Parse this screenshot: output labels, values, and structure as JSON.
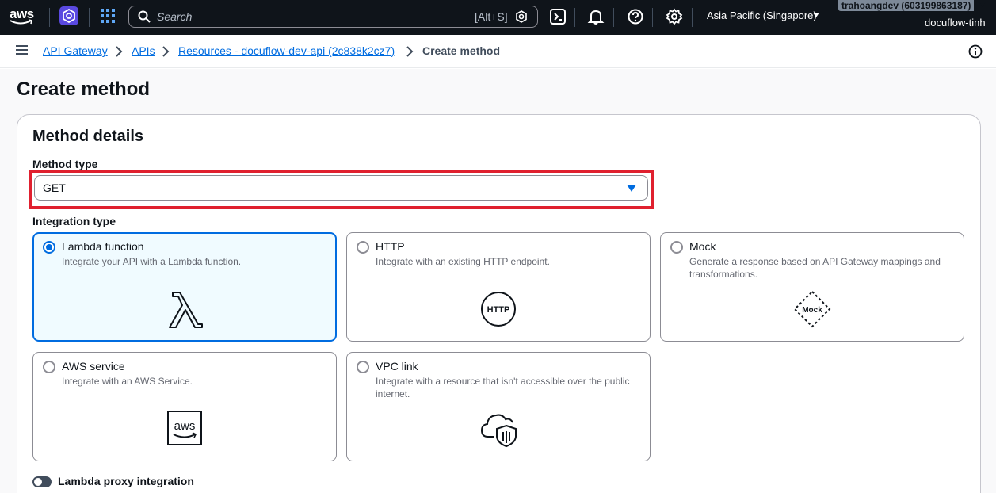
{
  "topnav": {
    "logo_text": "aws",
    "search_placeholder": "Search",
    "search_shortcut": "[Alt+S]",
    "region": "Asia Pacific (Singapore)",
    "account": "trahoangdev (603199863187)",
    "username": "docuflow-tinh",
    "icons": [
      "aws-logo",
      "service-icon",
      "apps-grid-icon",
      "search-icon",
      "cloudshell-icon",
      "bell-icon",
      "help-icon",
      "settings-icon"
    ]
  },
  "breadcrumb": {
    "items": [
      "API Gateway",
      "APIs",
      "Resources - docuflow-dev-api (2c838k2cz7)"
    ],
    "current": "Create method"
  },
  "page": {
    "title": "Create method"
  },
  "method_details": {
    "heading": "Method details",
    "method_type_label": "Method type",
    "method_type_value": "GET",
    "integration_type_label": "Integration type",
    "integration_options": [
      {
        "title": "Lambda function",
        "description": "Integrate your API with a Lambda function.",
        "selected": true,
        "icon": "lambda-icon"
      },
      {
        "title": "HTTP",
        "description": "Integrate with an existing HTTP endpoint.",
        "selected": false,
        "icon": "http-icon"
      },
      {
        "title": "Mock",
        "description": "Generate a response based on API Gateway mappings and transformations.",
        "selected": false,
        "icon": "mock-icon"
      },
      {
        "title": "AWS service",
        "description": "Integrate with an AWS Service.",
        "selected": false,
        "icon": "aws-service-icon"
      },
      {
        "title": "VPC link",
        "description": "Integrate with a resource that isn't accessible over the public internet.",
        "selected": false,
        "icon": "vpc-link-icon"
      }
    ],
    "icon_labels": {
      "http": "HTTP",
      "mock": "Mock",
      "aws": "aws"
    },
    "proxy_toggle_label": "Lambda proxy integration",
    "proxy_toggle_on": false
  },
  "colors": {
    "nav_bg": "#0f141a",
    "link": "#006ce0",
    "highlight": "#e0202f",
    "selected_bg": "#f0fbff"
  }
}
